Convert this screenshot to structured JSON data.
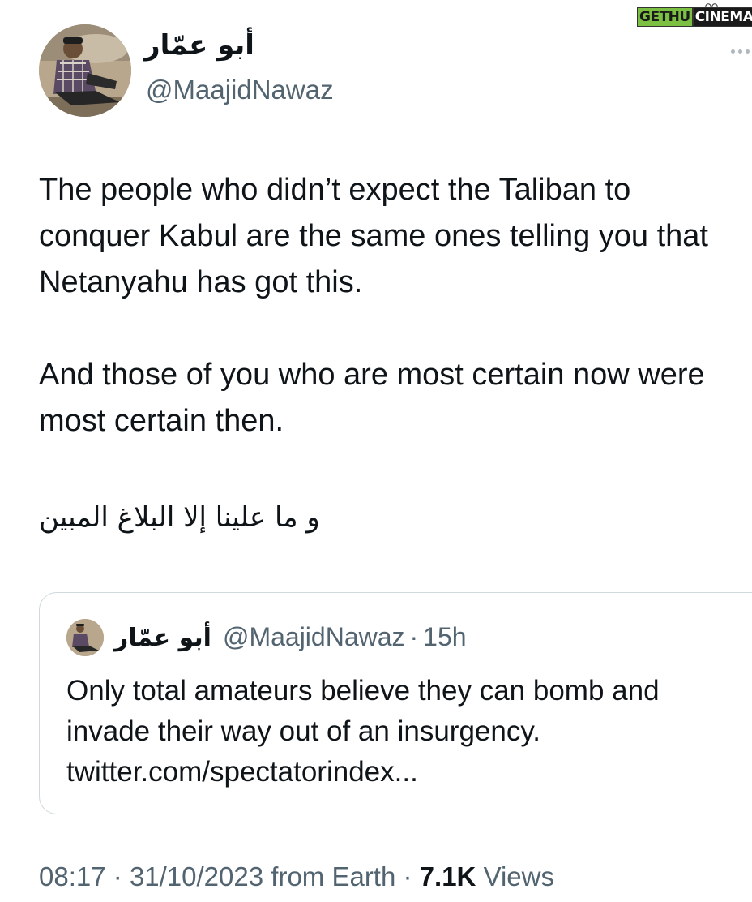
{
  "watermark": {
    "part1": "GETHU",
    "part2": "CINEMA"
  },
  "tweet": {
    "display_name": "أبو عمّار",
    "handle": "@MaajidNawaz",
    "paragraph1": "The people who didn’t expect the Taliban to conquer Kabul are the same ones telling you that Netanyahu has got this.",
    "paragraph2": "And those of you who are most certain now were most certain then.",
    "arabic_line": "و ما علينا إلا البلاغ المبين",
    "more_icon": "more-horizontal-icon"
  },
  "quoted": {
    "display_name": "أبو عمّار",
    "handle": "@MaajidNawaz",
    "separator": "·",
    "time": "15h",
    "line1": "Only total amateurs believe they can bomb and",
    "line2": "invade their way out of an insurgency.",
    "line3": "twitter.com/spectatorindex..."
  },
  "meta": {
    "time": "08:17",
    "sep1": "·",
    "date": "31/10/2023",
    "source": "from Earth",
    "sep2": "·",
    "views_count": "7.1K",
    "views_label": "Views"
  },
  "colors": {
    "text": "#0f1419",
    "secondary": "#536471",
    "border": "#cfd9de",
    "watermark_green": "#7bc043"
  }
}
